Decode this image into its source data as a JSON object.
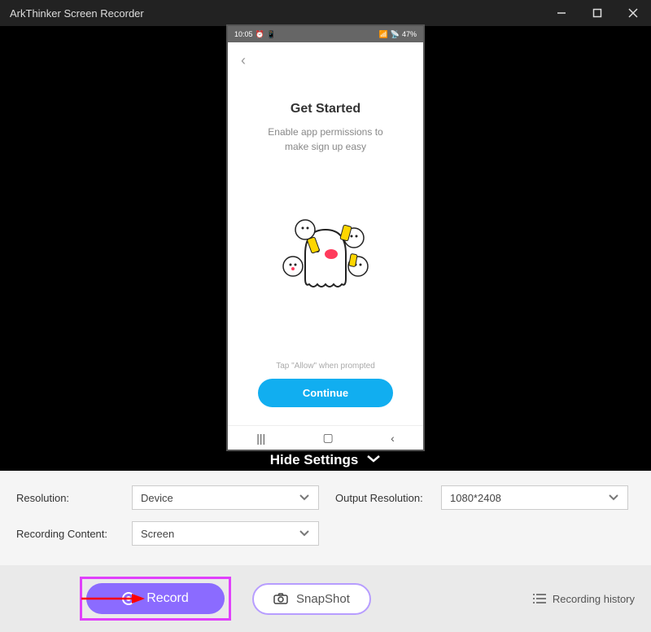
{
  "titlebar": {
    "title": "ArkThinker Screen Recorder"
  },
  "phone": {
    "time": "10:05",
    "battery": "47%",
    "title": "Get Started",
    "subtitle_line1": "Enable app permissions to",
    "subtitle_line2": "make sign up easy",
    "hint": "Tap \"Allow\" when prompted",
    "continue_label": "Continue"
  },
  "hide_settings_label": "Hide Settings",
  "settings": {
    "resolution_label": "Resolution:",
    "resolution_value": "Device",
    "output_resolution_label": "Output Resolution:",
    "output_resolution_value": "1080*2408",
    "recording_content_label": "Recording Content:",
    "recording_content_value": "Screen"
  },
  "actions": {
    "record_label": "Record",
    "snapshot_label": "SnapShot",
    "history_label": "Recording history"
  }
}
